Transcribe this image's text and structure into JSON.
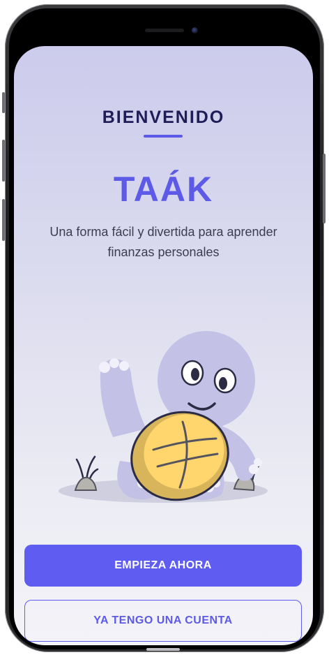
{
  "welcome": {
    "heading": "BIENVENIDO",
    "brand": "TAÁK",
    "tagline": "Una forma fácil y divertida para aprender finanzas personales"
  },
  "illustration": {
    "icon": "turtle-mascot-illustration"
  },
  "actions": {
    "primary_label": "EMPIEZA AHORA",
    "secondary_label": "YA TENGO UNA CUENTA"
  },
  "colors": {
    "accent": "#5c5ae6",
    "heading": "#1f1c57",
    "button": "#5f5cf2",
    "shell": "#ffd66e"
  }
}
